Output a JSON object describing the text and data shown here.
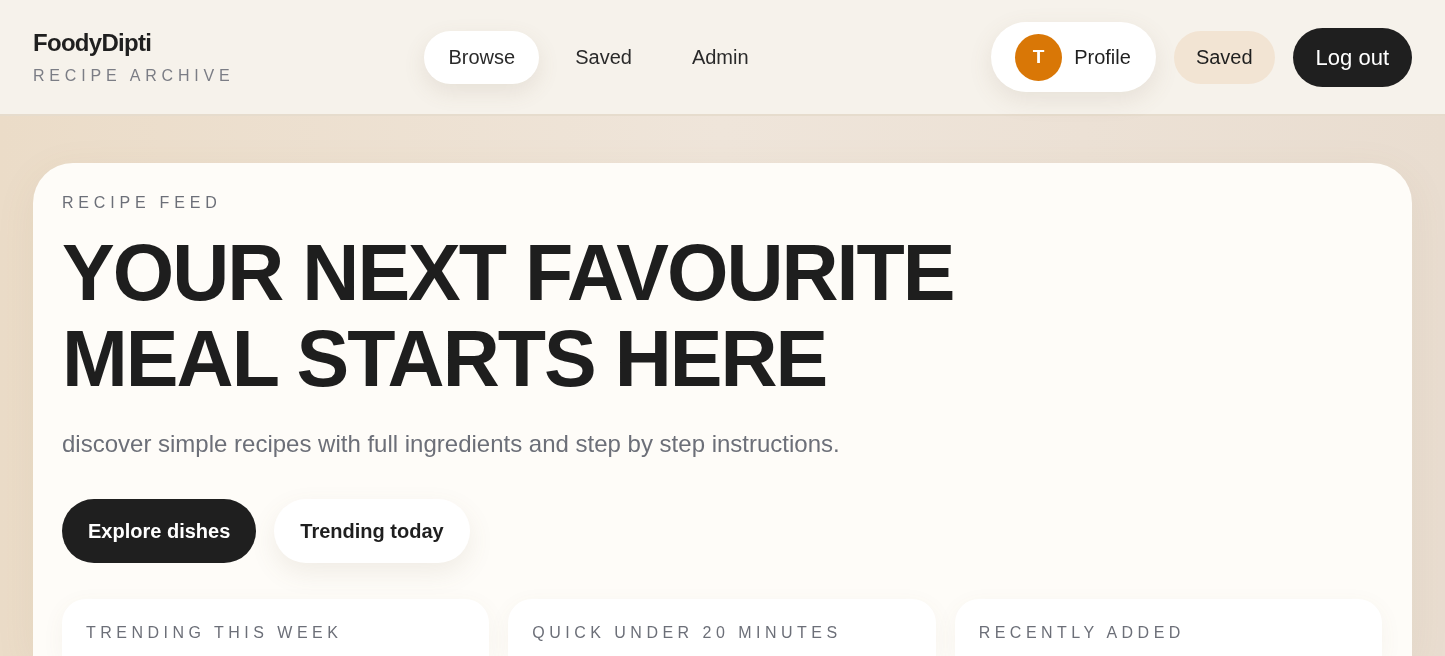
{
  "brand": {
    "name": "FoodyDipti",
    "tagline": "RECIPE ARCHIVE"
  },
  "nav": [
    {
      "label": "Browse",
      "selected": true
    },
    {
      "label": "Saved",
      "selected": false
    },
    {
      "label": "Admin",
      "selected": false
    }
  ],
  "profile": {
    "initial": "T",
    "label": "Profile"
  },
  "actions": [
    {
      "label": "Saved",
      "kind": "soft"
    },
    {
      "label": "Log out",
      "kind": "dark"
    }
  ],
  "hero": {
    "eyebrow": "RECIPE FEED",
    "title": "YOUR NEXT FAVOURITE MEAL STARTS HERE",
    "subtitle": "discover simple recipes with full ingredients and step by step instructions.",
    "buttons": [
      {
        "label": "Explore dishes",
        "kind": "primary"
      },
      {
        "label": "Trending today",
        "kind": "secondary"
      }
    ]
  },
  "sections": [
    {
      "title": "TRENDING THIS WEEK"
    },
    {
      "title": "QUICK UNDER 20 MINUTES"
    },
    {
      "title": "RECENTLY ADDED"
    }
  ]
}
